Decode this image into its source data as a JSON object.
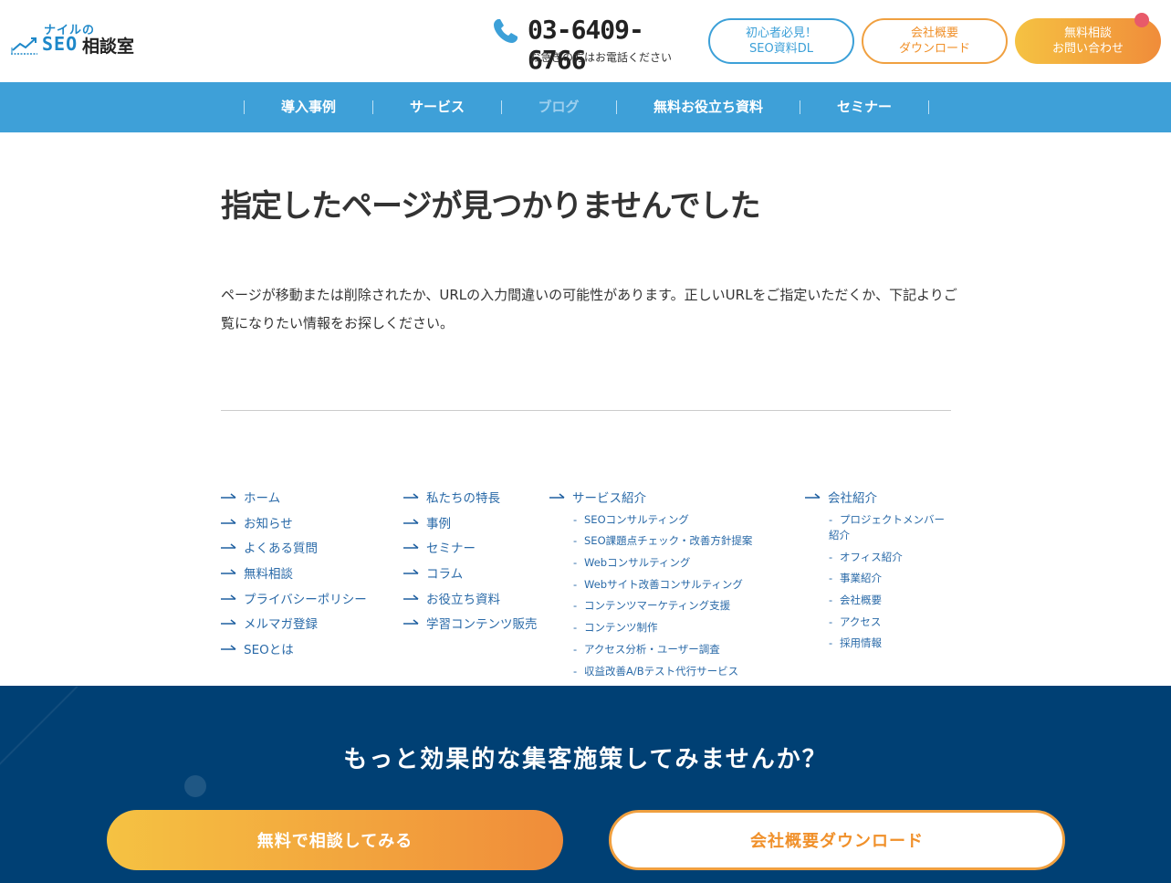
{
  "header": {
    "logo": {
      "small": "ナイルの",
      "seo": "SEO",
      "kanji": "相談室"
    },
    "phone": {
      "number": "03-6409-6766",
      "note": "お急ぎの方はお電話ください"
    },
    "buttons": [
      {
        "line1": "初心者必見！",
        "line2": "SEO資料DL"
      },
      {
        "line1": "会社概要",
        "line2": "ダウンロード"
      },
      {
        "line1": "無料相談",
        "line2": "お問い合わせ"
      }
    ],
    "accent_blue": "#3ea0d8",
    "accent_orange": "#f0902a"
  },
  "nav": {
    "items": [
      {
        "label": "導入事例"
      },
      {
        "label": "サービス"
      },
      {
        "label": "ブログ"
      },
      {
        "label": "無料お役立ち資料"
      },
      {
        "label": "セミナー"
      }
    ]
  },
  "main": {
    "title": "指定したページが見つかりませんでした",
    "description": "ページが移動または削除されたか、URLの入力間違いの可能性があります。正しいURLをご指定いただくか、下記よりご覧になりたい情報をお探しください。"
  },
  "sitemap": {
    "col1": [
      "ホーム",
      "お知らせ",
      "よくある質問",
      "無料相談",
      "プライバシーポリシー",
      "メルマガ登録",
      "SEOとは"
    ],
    "col2": [
      "私たちの特長",
      "事例",
      "セミナー",
      "コラム",
      "お役立ち資料",
      "学習コンテンツ販売"
    ],
    "col3": {
      "heading": "サービス紹介",
      "items": [
        "SEOコンサルティング",
        "SEO課題点チェック・改善方針提案",
        "Webコンサルティング",
        "Webサイト改善コンサルティング",
        "コンテンツマーケティング支援",
        "コンテンツ制作",
        "アクセス分析・ユーザー調査",
        "収益改善A/Bテスト代行サービス"
      ]
    },
    "col4": {
      "heading": "会社紹介",
      "items": [
        "プロジェクトメンバー紹介",
        "オフィス紹介",
        "事業紹介",
        "会社概要",
        "アクセス",
        "採用情報"
      ]
    }
  },
  "cta": {
    "title": "もっと効果的な集客施策してみませんか？",
    "primary": "無料で相談してみる",
    "secondary": "会社概要ダウンロード"
  }
}
